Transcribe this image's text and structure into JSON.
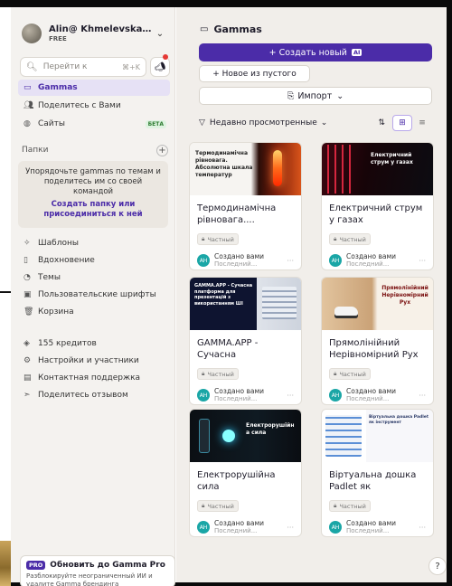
{
  "account": {
    "name": "Alin@ Khmelevska W...",
    "plan": "FREE"
  },
  "search": {
    "placeholder": "Перейти к",
    "shortcut": "⌘+K"
  },
  "nav": [
    {
      "label": "Gammas",
      "icon": "gammas-icon",
      "active": true
    },
    {
      "label": "Поделитесь с Вами",
      "icon": "shared-users-icon"
    },
    {
      "label": "Сайты",
      "icon": "globe-icon",
      "badge": "БЕТА"
    }
  ],
  "folders": {
    "title": "Папки",
    "description": "Упорядочьте gammas по темам и поделитесь им со своей командой",
    "link": "Создать папку или присоединиться к ней"
  },
  "tools": [
    {
      "label": "Шаблоны",
      "icon": "templates-icon"
    },
    {
      "label": "Вдохновение",
      "icon": "inspiration-icon"
    },
    {
      "label": "Темы",
      "icon": "palette-icon"
    },
    {
      "label": "Пользовательские шрифты",
      "icon": "font-icon"
    },
    {
      "label": "Корзина",
      "icon": "trash-icon"
    }
  ],
  "misc": [
    {
      "label": "155 кредитов",
      "icon": "credits-icon"
    },
    {
      "label": "Настройки и участники",
      "icon": "settings-icon"
    },
    {
      "label": "Контактная поддержка",
      "icon": "support-icon"
    },
    {
      "label": "Поделитесь отзывом",
      "icon": "feedback-icon"
    }
  ],
  "pro": {
    "badge": "PRO",
    "title": "Обновить до Gamma Pro",
    "description": "Разблокируйте неограниченный ИИ и удалите Gamma брендинга"
  },
  "main": {
    "title": "Gammas",
    "create_label": "+ Создать новый",
    "ai_badge": "AI",
    "blank_label": "+ Новое из пустого",
    "import_label": "Импорт",
    "sort_label": "Недавно просмотренные"
  },
  "cards": [
    {
      "title": "Термодинамічна рівновага....",
      "thumb_title": "Термодинамічна рівновага. Абсолютна шкала температур",
      "thumb_sub": "",
      "badge": "Частный",
      "author": "Создано вами",
      "date": "Последний...",
      "initials": "AH"
    },
    {
      "title": "Електричний струм у газах",
      "thumb_title": "Електричний струм у газах",
      "thumb_sub": "",
      "badge": "Частный",
      "author": "Создано вами",
      "date": "Последний...",
      "initials": "AH"
    },
    {
      "title": "GAMMA.APP - Сучасна платформ...",
      "thumb_title": "GAMMA.APP - Сучасна платформа для презентацій з використанням ШІ",
      "thumb_sub": "",
      "badge": "Частный",
      "author": "Создано вами",
      "date": "Последний...",
      "initials": "AH"
    },
    {
      "title": "Прямолінійний Нерівномірний Рух",
      "thumb_title": "Прямолінійний Нерівномірний Рух",
      "thumb_sub": "",
      "badge": "Частный",
      "author": "Создано вами",
      "date": "Последний...",
      "initials": "AH"
    },
    {
      "title": "Електрорушійна сила",
      "thumb_title": "Електрорушійн а сила",
      "thumb_sub": "",
      "badge": "Частный",
      "author": "Создано вами",
      "date": "Последний...",
      "initials": "AH"
    },
    {
      "title": "Віртуальна дошка Padlet як інструмен...",
      "thumb_title": "Віртуальна дошка Padlet як інструмент",
      "thumb_sub": "",
      "badge": "Частный",
      "author": "Создано вами",
      "date": "Последний...",
      "initials": "AH"
    }
  ],
  "help": {
    "label": "?"
  },
  "colors": {
    "accent": "#4b2ca8",
    "sidebar_bg": "#f4f2ef",
    "main_bg": "#f1eeea"
  }
}
